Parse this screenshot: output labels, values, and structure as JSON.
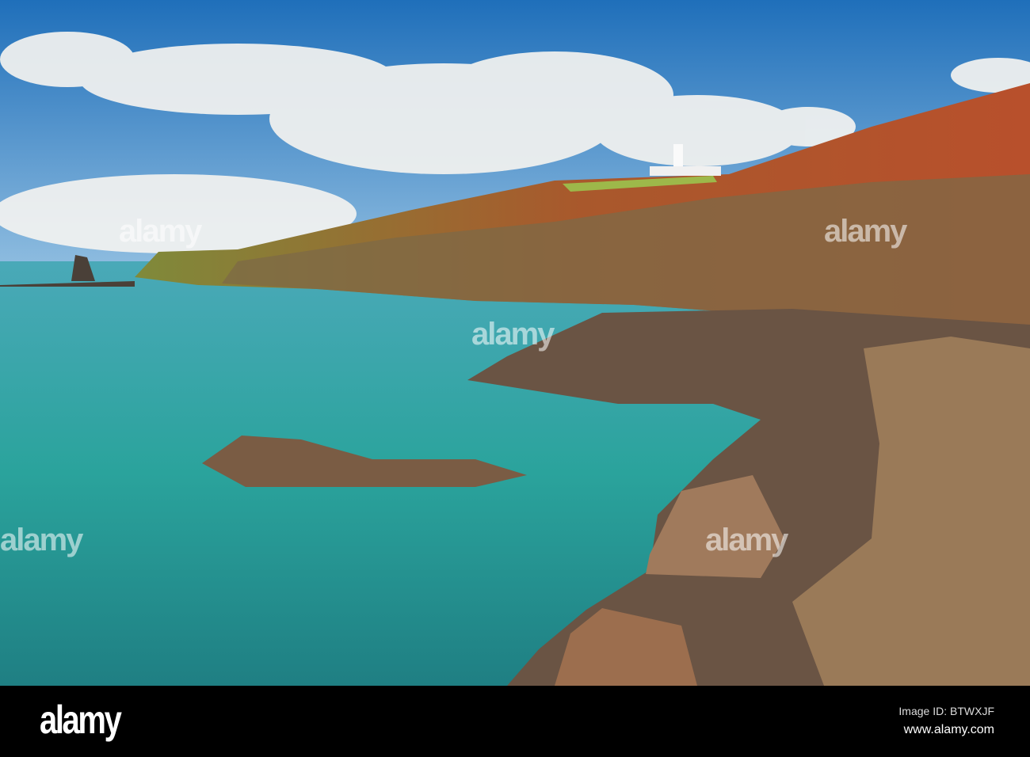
{
  "photo": {
    "subject": "coastal cliffs with lighthouse and turquoise sea"
  },
  "watermark": {
    "text": "alamy"
  },
  "footer": {
    "logo": "alamy",
    "image_id": "Image ID: BTWXJF",
    "website": "www.alamy.com"
  },
  "colors": {
    "sky": "#2f7fc4",
    "sea": "#2fa3a3",
    "cliff_grass": "#b5552e",
    "rock": "#6e5a48"
  }
}
